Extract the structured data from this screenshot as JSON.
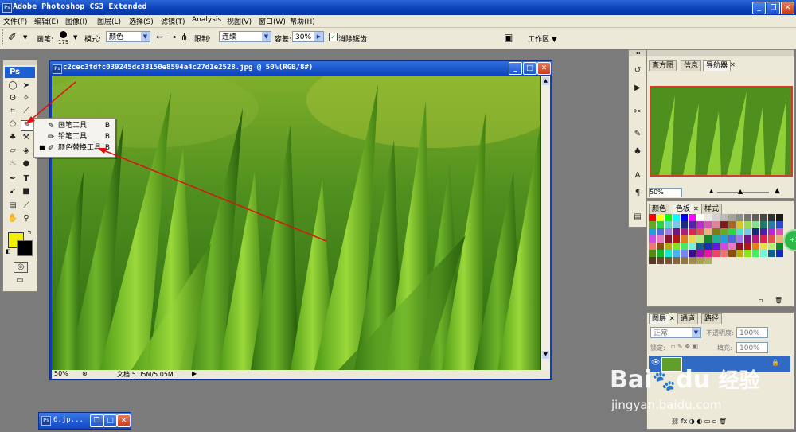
{
  "app": {
    "title": "Adobe Photoshop CS3 Extended",
    "logo": "Ps"
  },
  "menu": [
    "文件(F)",
    "编辑(E)",
    "图像(I)",
    "图层(L)",
    "选择(S)",
    "滤镜(T)",
    "Analysis",
    "视图(V)",
    "窗口(W)",
    "帮助(H)"
  ],
  "options": {
    "brush_label": "画笔:",
    "brush_size": "179",
    "mode_label": "模式:",
    "mode_value": "颜色",
    "limit_label": "限制:",
    "limit_value": "连续",
    "tolerance_label": "容差:",
    "tolerance_value": "30%",
    "antialias_label": "消除锯齿",
    "workspace_label": "工作区 ▼"
  },
  "document": {
    "title": "c2cec3fdfc039245dc33150e8594a4c27d1e2528.jpg @ 50%(RGB/8#)",
    "zoom": "50%",
    "doc_info": "文档:5.05M/5.05M"
  },
  "flyout": [
    {
      "label": "画笔工具",
      "key": "B",
      "active": false
    },
    {
      "label": "铅笔工具",
      "key": "B",
      "active": false
    },
    {
      "label": "颜色替换工具",
      "key": "B",
      "active": true
    }
  ],
  "navigator": {
    "tabs": [
      "直方图",
      "信息",
      "导航器"
    ],
    "zoom": "50%"
  },
  "swatches": {
    "tabs": [
      "颜色",
      "色板",
      "样式"
    ]
  },
  "layers": {
    "tabs": [
      "图层",
      "通道",
      "路径"
    ],
    "blend_mode": "正常",
    "opacity_label": "不透明度:",
    "opacity_value": "100%",
    "lock_label": "锁定:",
    "fill_label": "填充:",
    "fill_value": "100%"
  },
  "minimized_doc": {
    "title": "6.jp..."
  },
  "colors": {
    "foreground": "#f2f200",
    "background": "#000000",
    "accent": "#0a3fb8"
  },
  "watermark": {
    "brand": "Bai",
    "brand2": "du",
    "cn": "经验",
    "url": "jingyan.baidu.com"
  },
  "badge": "+3"
}
